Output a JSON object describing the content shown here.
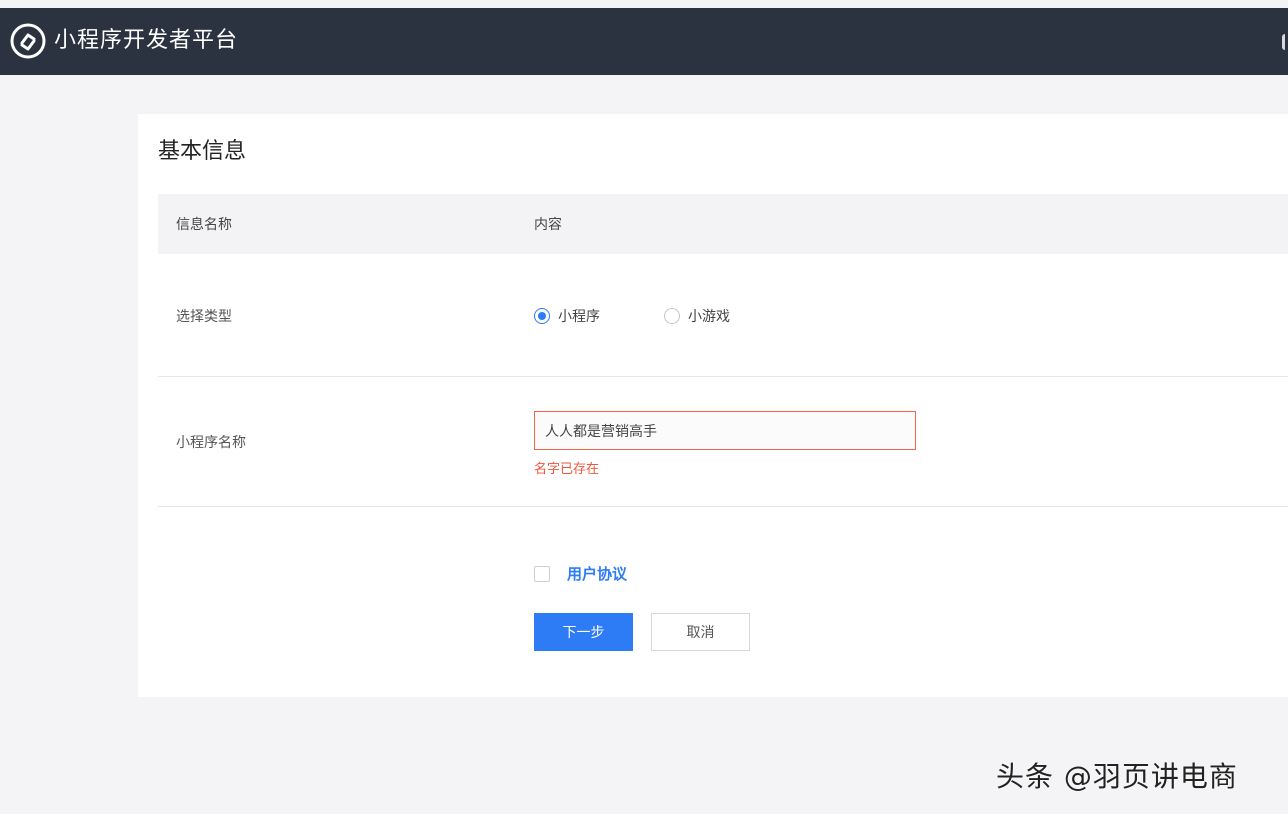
{
  "header": {
    "app_title": "小程序开发者平台",
    "logo_icon": "mini-program-logo-icon",
    "bg_color": "#2b3340"
  },
  "main": {
    "section_title": "基本信息",
    "table_header": {
      "name_col": "信息名称",
      "content_col": "内容"
    },
    "type_row": {
      "label": "选择类型",
      "options": [
        {
          "label": "小程序",
          "checked": true
        },
        {
          "label": "小游戏",
          "checked": false
        }
      ]
    },
    "name_row": {
      "label": "小程序名称",
      "value": "人人都是营销高手",
      "error": "名字已存在"
    },
    "agreement": {
      "checked": false,
      "link_label": "用户协议"
    },
    "buttons": {
      "next_label": "下一步",
      "cancel_label": "取消"
    }
  },
  "watermark": "头条 @羽页讲电商",
  "colors": {
    "accent": "#2d7cf6",
    "error": "#f0553c"
  }
}
